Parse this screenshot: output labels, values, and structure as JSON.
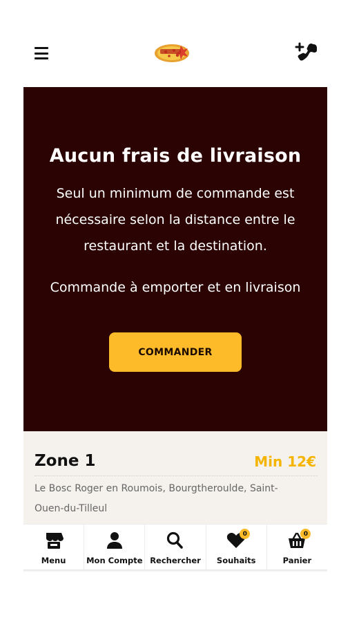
{
  "header": {
    "menu_icon": "hamburger-icon",
    "logo_icon": "pizza-logo",
    "phone_icon": "phone-plus-icon"
  },
  "hero": {
    "title": "Aucun frais de livraison",
    "text1": "Seul un minimum de commande est nécessaire selon la distance entre le restaurant et la destination.",
    "text2": "Commande à emporter et en livraison",
    "button_label": "COMMANDER",
    "background_color": "#2b0303",
    "accent_color": "#fdbb2a"
  },
  "zone": {
    "title": "Zone 1",
    "min": "Min 12€",
    "cities": "Le Bosc Roger en Roumois, Bourgtheroulde, Saint-Ouen-du-Tilleul"
  },
  "bottom_nav": {
    "items": [
      {
        "label": "Menu",
        "icon": "store-icon"
      },
      {
        "label": "Mon Compte",
        "icon": "user-icon"
      },
      {
        "label": "Rechercher",
        "icon": "search-icon"
      },
      {
        "label": "Souhaits",
        "icon": "heart-icon",
        "badge": "0"
      },
      {
        "label": "Panier",
        "icon": "basket-icon",
        "badge": "0"
      }
    ]
  }
}
